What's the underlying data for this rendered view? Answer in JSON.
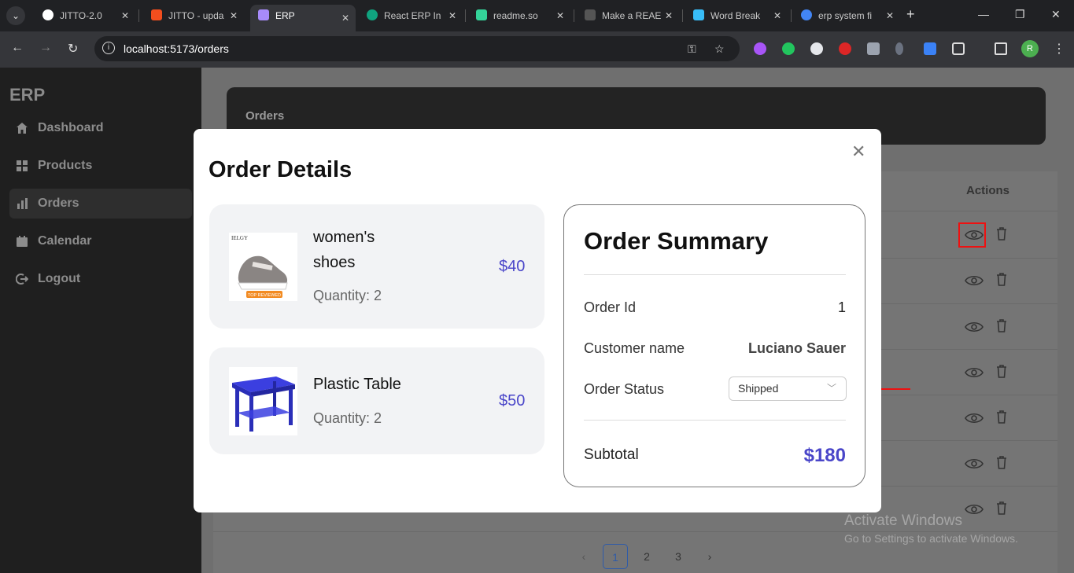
{
  "browser": {
    "tabs": [
      {
        "title": "JITTO-2.0",
        "fav": "#ffffff"
      },
      {
        "title": "JITTO - upda",
        "fav": "#f24e1e"
      },
      {
        "title": "ERP",
        "fav": "#a78bfa",
        "active": true
      },
      {
        "title": "React ERP In",
        "fav": "#10a37f"
      },
      {
        "title": "readme.so",
        "fav": "#34d399"
      },
      {
        "title": "Make a REAE",
        "fav": "#555555"
      },
      {
        "title": "Word Break",
        "fav": "#38bdf8"
      },
      {
        "title": "erp system fi",
        "fav": "#4285f4"
      }
    ],
    "url": "localhost:5173/orders",
    "profile_initial": "R"
  },
  "sidebar": {
    "brand": "ERP",
    "items": [
      {
        "label": "Dashboard",
        "icon": "home-icon"
      },
      {
        "label": "Products",
        "icon": "grid-icon"
      },
      {
        "label": "Orders",
        "icon": "bar-chart-icon",
        "active": true
      },
      {
        "label": "Calendar",
        "icon": "calendar-icon"
      },
      {
        "label": "Logout",
        "icon": "logout-icon"
      }
    ]
  },
  "page": {
    "header": "Orders",
    "actions_header": "Actions",
    "pagination": [
      "1",
      "2",
      "3"
    ],
    "current_page": "1"
  },
  "modal": {
    "title": "Order Details",
    "items": [
      {
        "name_line1": "women's",
        "name_line2": "shoes",
        "quantity": "Quantity: 2",
        "price": "$40",
        "image_text": "IELGY",
        "badge": "TOP REVIEWED"
      },
      {
        "name_line1": "Plastic Table",
        "name_line2": "",
        "quantity": "Quantity: 2",
        "price": "$50"
      }
    ],
    "summary": {
      "title": "Order Summary",
      "order_id_label": "Order Id",
      "order_id": "1",
      "customer_label": "Customer name",
      "customer": "Luciano Sauer",
      "status_label": "Order Status",
      "status": "Shipped",
      "subtotal_label": "Subtotal",
      "subtotal": "$180"
    }
  },
  "watermark": {
    "line1": "Activate Windows",
    "line2": "Go to Settings to activate Windows."
  },
  "colors": {
    "accent": "#4a46c9",
    "highlight": "#ee1111"
  }
}
